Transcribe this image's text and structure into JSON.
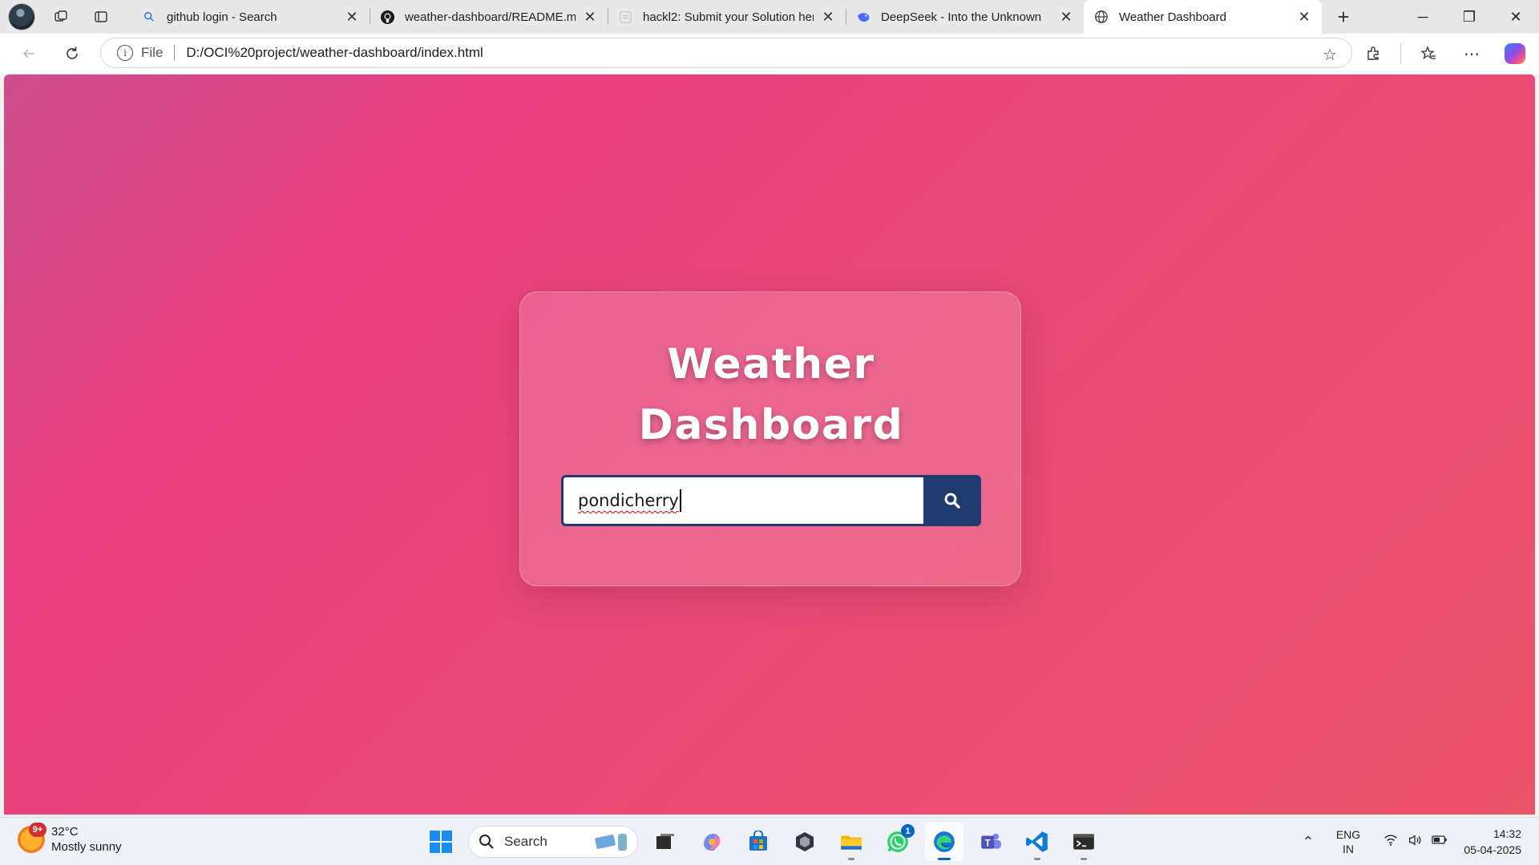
{
  "browser": {
    "tabs": [
      {
        "label": "github login - Search",
        "icon": "search-icon"
      },
      {
        "label": "weather-dashboard/README.md",
        "icon": "github-icon"
      },
      {
        "label": "hackl2: Submit your Solution here",
        "icon": "document-icon"
      },
      {
        "label": "DeepSeek - Into the Unknown",
        "icon": "deepseek-icon"
      },
      {
        "label": "Weather Dashboard",
        "icon": "globe-icon",
        "active": true
      }
    ],
    "address": {
      "scheme_label": "File",
      "url": "D:/OCI%20project/weather-dashboard/index.html"
    }
  },
  "page": {
    "title_line1": "Weather",
    "title_line2": "Dashboard",
    "search": {
      "value": "pondicherry"
    },
    "colors": {
      "background_start": "#cd4f8c",
      "background_end": "#eb5368",
      "button": "#1e3a6e"
    }
  },
  "taskbar": {
    "weather": {
      "temp": "32°C",
      "condition": "Mostly sunny",
      "badge": "9+"
    },
    "search_label": "Search",
    "whatsapp_badge": "1",
    "language": {
      "line1": "ENG",
      "line2": "IN"
    },
    "clock": {
      "time": "14:32",
      "date": "05-04-2025"
    }
  }
}
